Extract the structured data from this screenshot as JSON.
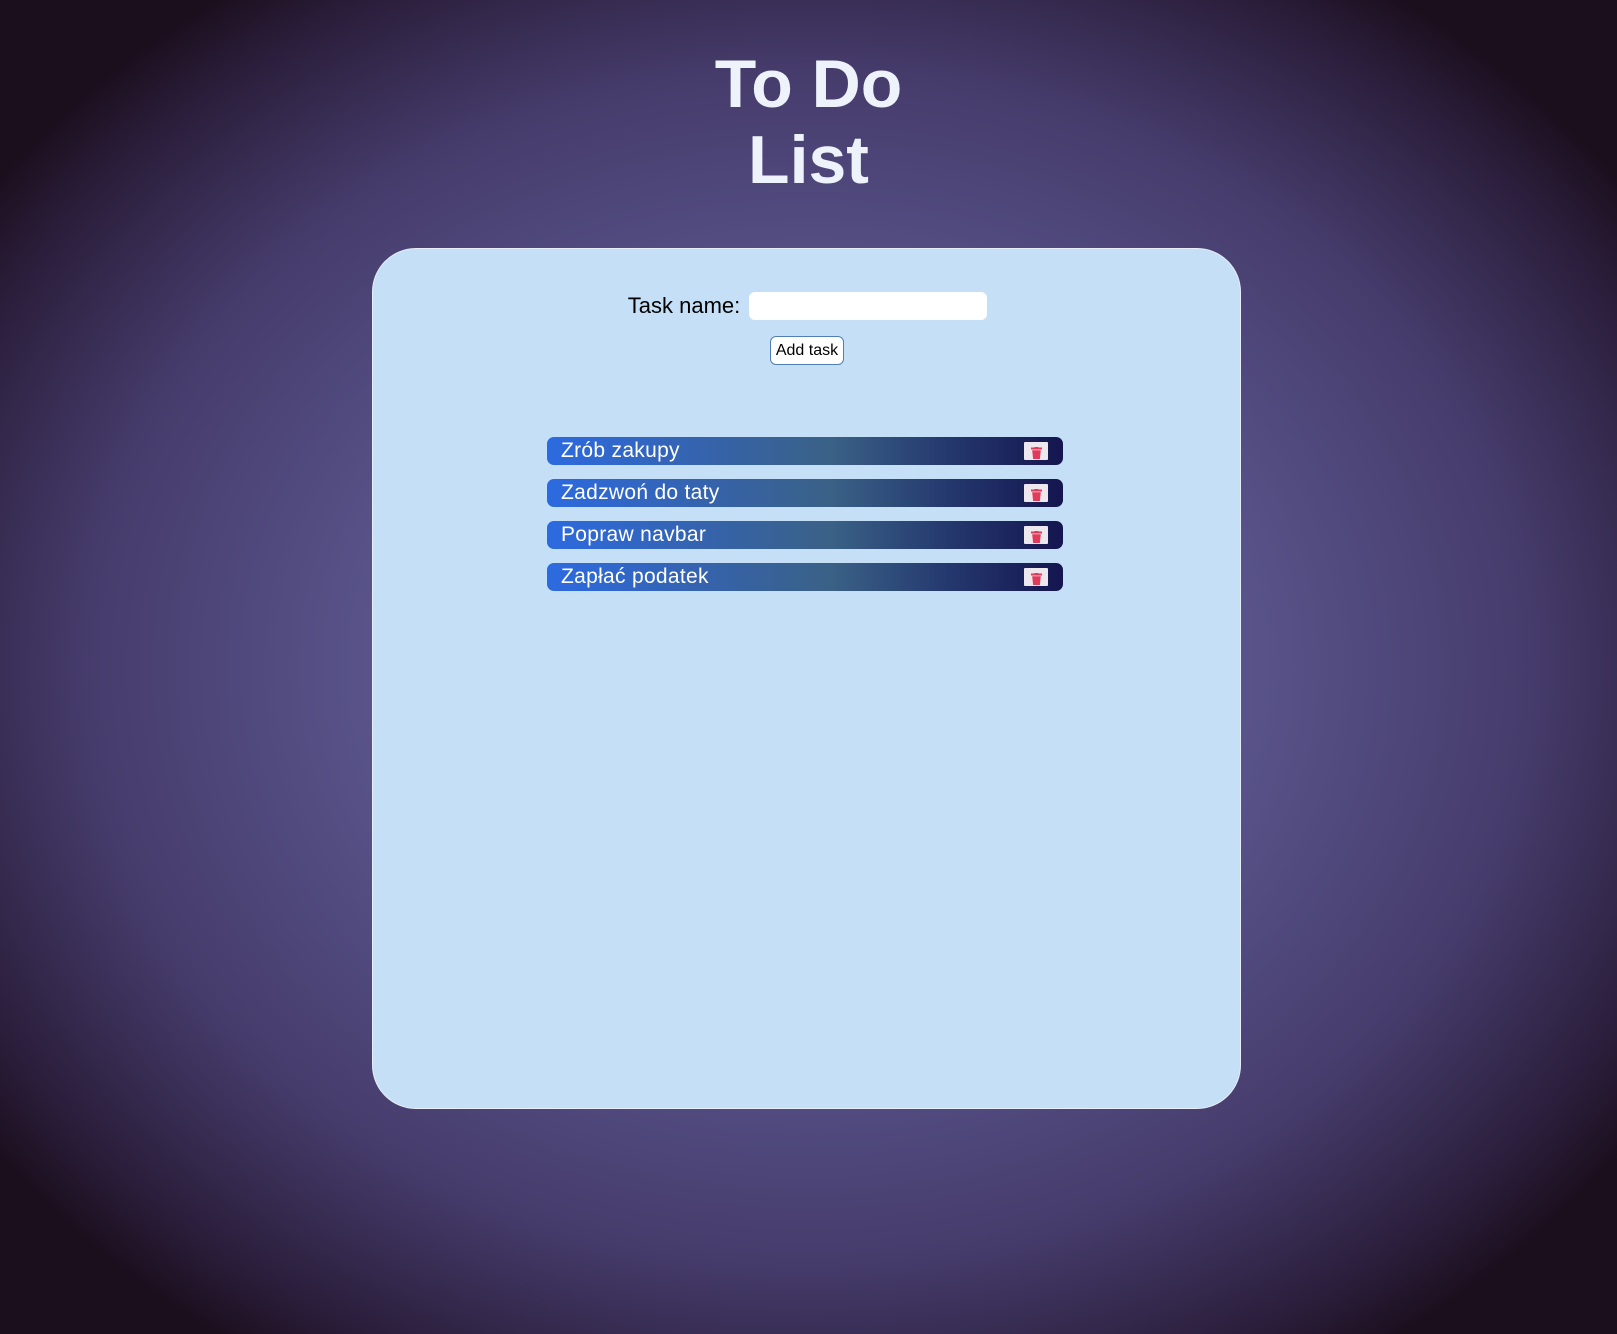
{
  "header": {
    "title_line1": "To Do",
    "title_line2": "List"
  },
  "form": {
    "label": "Task name:",
    "input_value": "",
    "input_placeholder": "",
    "add_button_label": "Add task"
  },
  "tasks": [
    {
      "text": "Zrób zakupy",
      "delete_icon": "trash-icon"
    },
    {
      "text": "Zadzwoń do taty",
      "delete_icon": "trash-icon"
    },
    {
      "text": "Popraw navbar",
      "delete_icon": "trash-icon"
    },
    {
      "text": "Zapłać podatek",
      "delete_icon": "trash-icon"
    }
  ],
  "colors": {
    "card_background": "#c5dff6",
    "title_text": "#eef2fb",
    "task_gradient_start": "#2c6ae0",
    "task_gradient_end": "#15154f",
    "trash_icon": "#e23b5a"
  }
}
